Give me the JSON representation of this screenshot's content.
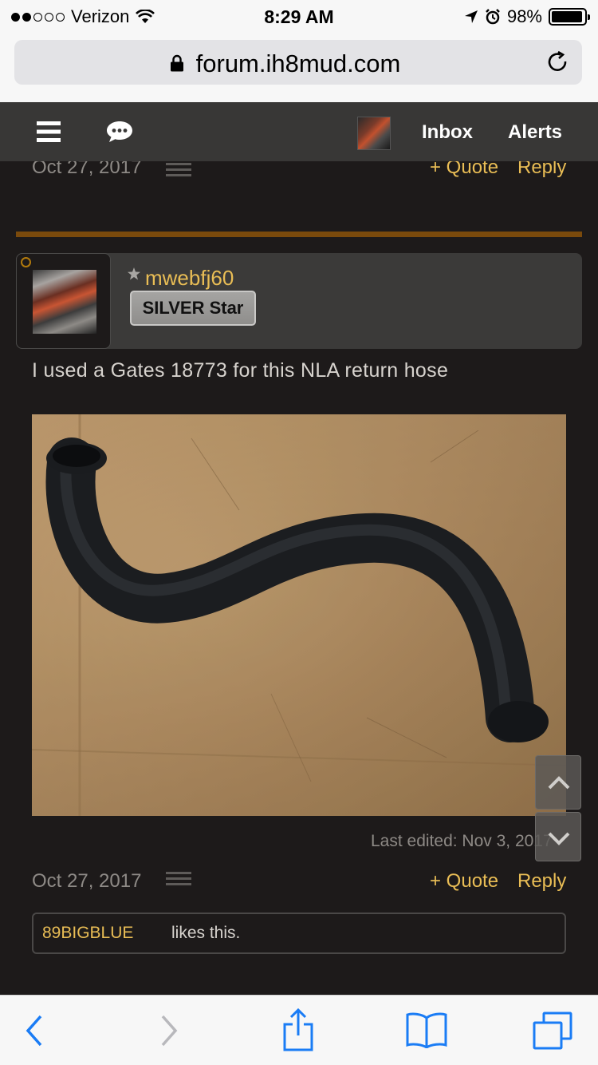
{
  "status_bar": {
    "carrier": "Verizon",
    "time": "8:29 AM",
    "battery": "98%",
    "battery_level": 0.98
  },
  "browser": {
    "url": "forum.ih8mud.com"
  },
  "forum_nav": {
    "inbox_label": "Inbox",
    "alerts_label": "Alerts"
  },
  "previous_post": {
    "date": "Oct 27, 2017",
    "quote_label": "+ Quote",
    "reply_label": "Reply"
  },
  "post": {
    "username": "mwebfj60",
    "rank": "SILVER Star",
    "message": "I used a Gates 18773 for this NLA return hose",
    "edited": "Last edited: Nov 3, 2017",
    "date": "Oct 27, 2017",
    "quote_label": "+ Quote",
    "reply_label": "Reply",
    "likes_user": "89BIGBLUE",
    "likes_text": "likes this."
  },
  "colors": {
    "accent": "#e9bd55",
    "divider": "#7a4a0c",
    "background": "#1d1a1a",
    "ios_blue": "#1a7cf5"
  },
  "icons": [
    "signal-icon",
    "wifi-icon",
    "location-icon",
    "alarm-icon",
    "battery-icon",
    "lock-icon",
    "reload-icon",
    "menu-icon",
    "chat-icon",
    "star-icon",
    "chevron-up-icon",
    "chevron-down-icon",
    "back-icon",
    "forward-icon",
    "share-icon",
    "bookmarks-icon",
    "tabs-icon"
  ]
}
